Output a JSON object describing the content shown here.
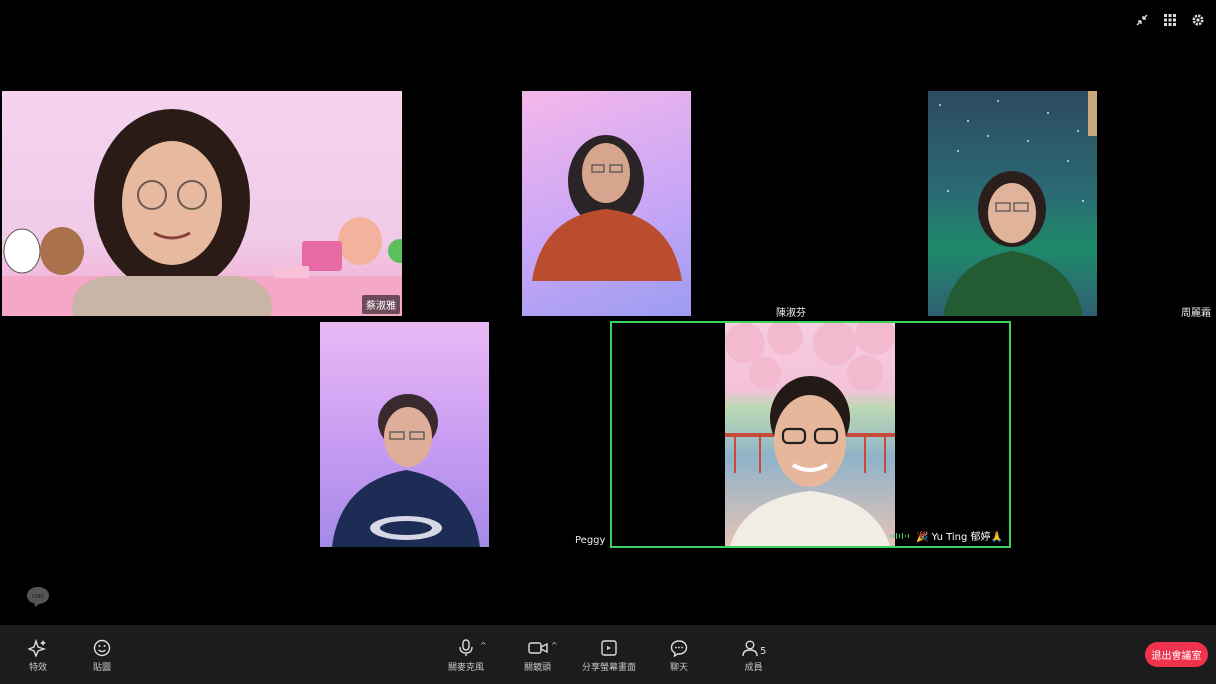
{
  "participants": {
    "p1": {
      "name": "蔡淑雅"
    },
    "p2": {
      "name": "陳淑芬"
    },
    "p3": {
      "name": "周麗霜"
    },
    "p4": {
      "name": "Peggy"
    },
    "p5": {
      "name": "🎉 Yu Ting 郁婷🙏",
      "speaking": true
    }
  },
  "toolbar": {
    "effects": "特效",
    "stickers": "貼圖",
    "mic": "關麥克風",
    "camera": "關鏡頭",
    "share": "分享螢幕畫面",
    "chat": "聊天",
    "members": "成員",
    "member_count": "5",
    "exit": "退出會議室"
  },
  "icons": [
    "minimize-icon",
    "grid-view-icon",
    "settings-icon",
    "line-logo-icon"
  ],
  "colors": {
    "active_border": "#3ad25f",
    "exit_button": "#f0334d",
    "toolbar_bg": "#1c1c1c"
  }
}
